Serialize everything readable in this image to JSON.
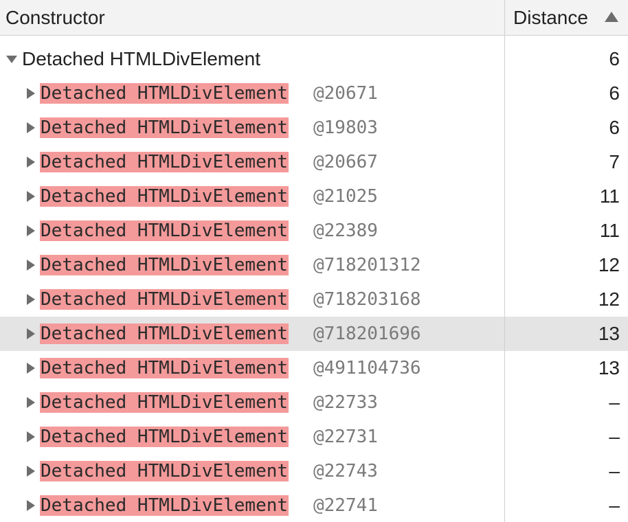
{
  "columns": {
    "constructor": "Constructor",
    "distance": "Distance"
  },
  "sort": {
    "column": "distance",
    "direction": "ascending",
    "icon": "triangle-up-icon"
  },
  "parent": {
    "label": "Detached HTMLDivElement",
    "distance": "6",
    "expanded": true
  },
  "children": [
    {
      "label": "Detached HTMLDivElement",
      "id": "@20671",
      "distance": "6",
      "selected": false
    },
    {
      "label": "Detached HTMLDivElement",
      "id": "@19803",
      "distance": "6",
      "selected": false
    },
    {
      "label": "Detached HTMLDivElement",
      "id": "@20667",
      "distance": "7",
      "selected": false
    },
    {
      "label": "Detached HTMLDivElement",
      "id": "@21025",
      "distance": "11",
      "selected": false
    },
    {
      "label": "Detached HTMLDivElement",
      "id": "@22389",
      "distance": "11",
      "selected": false
    },
    {
      "label": "Detached HTMLDivElement",
      "id": "@718201312",
      "distance": "12",
      "selected": false
    },
    {
      "label": "Detached HTMLDivElement",
      "id": "@718203168",
      "distance": "12",
      "selected": false
    },
    {
      "label": "Detached HTMLDivElement",
      "id": "@718201696",
      "distance": "13",
      "selected": true
    },
    {
      "label": "Detached HTMLDivElement",
      "id": "@491104736",
      "distance": "13",
      "selected": false
    },
    {
      "label": "Detached HTMLDivElement",
      "id": "@22733",
      "distance": "–",
      "selected": false
    },
    {
      "label": "Detached HTMLDivElement",
      "id": "@22731",
      "distance": "–",
      "selected": false
    },
    {
      "label": "Detached HTMLDivElement",
      "id": "@22743",
      "distance": "–",
      "selected": false
    },
    {
      "label": "Detached HTMLDivElement",
      "id": "@22741",
      "distance": "–",
      "selected": false
    }
  ],
  "colors": {
    "detached_highlight": "#f49a9a",
    "selected_row": "#e4e4e4",
    "header_background": "#f3f3f3",
    "id_text": "#7a7a7a"
  }
}
